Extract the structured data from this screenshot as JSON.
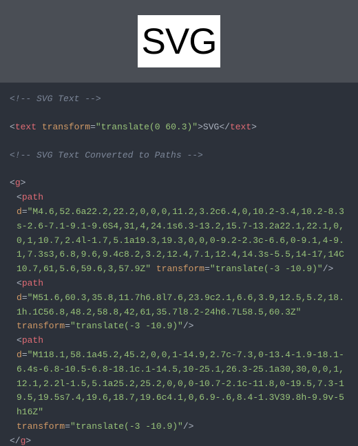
{
  "preview": {
    "svg_text": "SVG"
  },
  "code": {
    "comment1": "<!-- SVG Text -->",
    "text_open_punct1": "<",
    "text_open_tag": "text",
    "text_attr1_name": "transform",
    "text_attr1_eq": "=",
    "text_attr1_val": "\"translate(0 60.3)\"",
    "text_open_punct2": ">",
    "text_content": "SVG",
    "text_close_punct1": "</",
    "text_close_tag": "text",
    "text_close_punct2": ">",
    "comment2": "<!-- SVG Text Converted to Paths -->",
    "g_open_p1": "<",
    "g_open_tag": "g",
    "g_open_p2": ">",
    "path1_p1": "<",
    "path1_tag": "path",
    "path1_d_attr": "d",
    "path1_d_eq": "=",
    "path1_d_val": "\"M4.6,52.6a22.2,22.2,0,0,0,11.2,3.2c6.4,0,10.2-3.4,10.2-8.3s-2.6-7.1-9.1-9.6S4,31,4,24.1s6.3-13.2,15.7-13.2a22.1,22.1,0,0,1,10.7,2.4l-1.7,5.1a19.3,19.3,0,0,0-9.2-2.3c-6.6,0-9.1,4-9.1,7.3s3,6.8,9.6,9.4c8.2,3.2,12.4,7.1,12.4,14.3s-5.5,14-17,14C10.7,61,5.6,59.6,3,57.9Z\"",
    "path1_t_attr": "transform",
    "path1_t_eq": "=",
    "path1_t_val": "\"translate(-3 -10.9)\"",
    "path1_p2": "/>",
    "path2_p1": "<",
    "path2_tag": "path",
    "path2_d_attr": "d",
    "path2_d_eq": "=",
    "path2_d_val": "\"M51.6,60.3,35.8,11.7h6.8l7.6,23.9c2.1,6.6,3.9,12.5,5.2,18.1h.1C56.8,48.2,58.8,42,61,35.7l8.2-24h6.7L58.5,60.3Z\"",
    "path2_t_attr": "transform",
    "path2_t_eq": "=",
    "path2_t_val": "\"translate(-3 -10.9)\"",
    "path2_p2": "/>",
    "path3_p1": "<",
    "path3_tag": "path",
    "path3_d_attr": "d",
    "path3_d_eq": "=",
    "path3_d_val": "\"M118.1,58.1a45.2,45.2,0,0,1-14.9,2.7c-7.3,0-13.4-1.9-18.1-6.4s-6.8-10.5-6.8-18.1c.1-14.5,10-25.1,26.3-25.1a30,30,0,0,1,12.1,2.2l-1.5,5.1a25.2,25.2,0,0,0-10.7-2.1c-11.8,0-19.5,7.3-19.5,19.5s7.4,19.6,18.7,19.6c4.1,0,6.9-.6,8.4-1.3V39.8h-9.9v-5h16Z\"",
    "path3_t_attr": "transform",
    "path3_t_eq": "=",
    "path3_t_val": "\"translate(-3 -10.9)\"",
    "path3_p2": "/>",
    "g_close_p1": "</",
    "g_close_tag": "g",
    "g_close_p2": ">"
  }
}
